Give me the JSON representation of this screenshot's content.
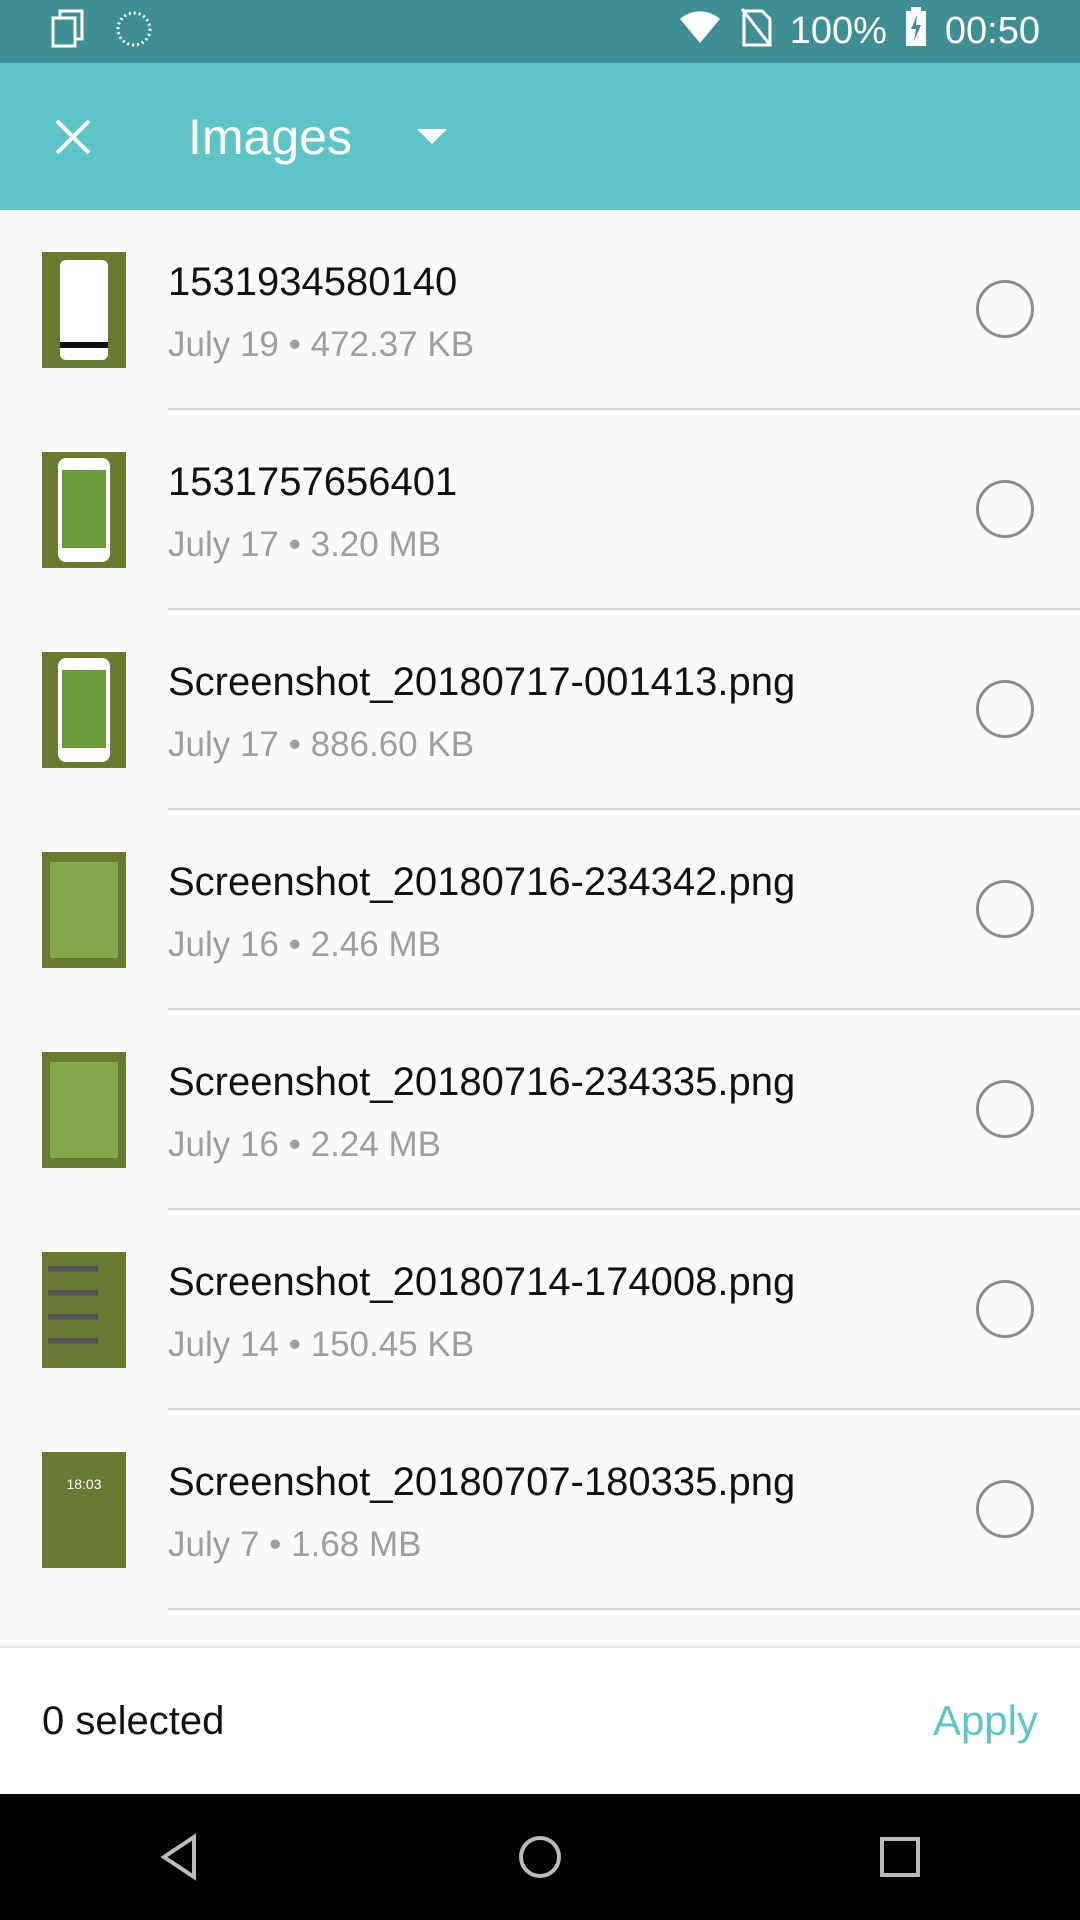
{
  "status_bar": {
    "battery": "100%",
    "time": "00:50",
    "icons": [
      "copy-icon",
      "spinner-icon",
      "wifi-icon",
      "no-sim-icon",
      "battery-charging-icon"
    ]
  },
  "toolbar": {
    "title": "Images",
    "close_icon": "close-icon",
    "dropdown_icon": "dropdown-arrow-icon",
    "accent": "#5ec4c8"
  },
  "files": [
    {
      "name": "1531934580140",
      "meta": "July 19 • 472.37 KB"
    },
    {
      "name": "1531757656401",
      "meta": "July 17 • 3.20 MB"
    },
    {
      "name": "Screenshot_20180717-001413.png",
      "meta": "July 17 • 886.60 KB"
    },
    {
      "name": "Screenshot_20180716-234342.png",
      "meta": "July 16 • 2.46 MB"
    },
    {
      "name": "Screenshot_20180716-234335.png",
      "meta": "July 16 • 2.24 MB"
    },
    {
      "name": "Screenshot_20180714-174008.png",
      "meta": "July 14 • 150.45 KB"
    },
    {
      "name": "Screenshot_20180707-180335.png",
      "meta": "July 7 • 1.68 MB"
    }
  ],
  "lock_thumb_time": "18:03",
  "bottom": {
    "selected": "0 selected",
    "apply": "Apply"
  },
  "nav": [
    "back-icon",
    "home-icon",
    "recents-icon"
  ]
}
